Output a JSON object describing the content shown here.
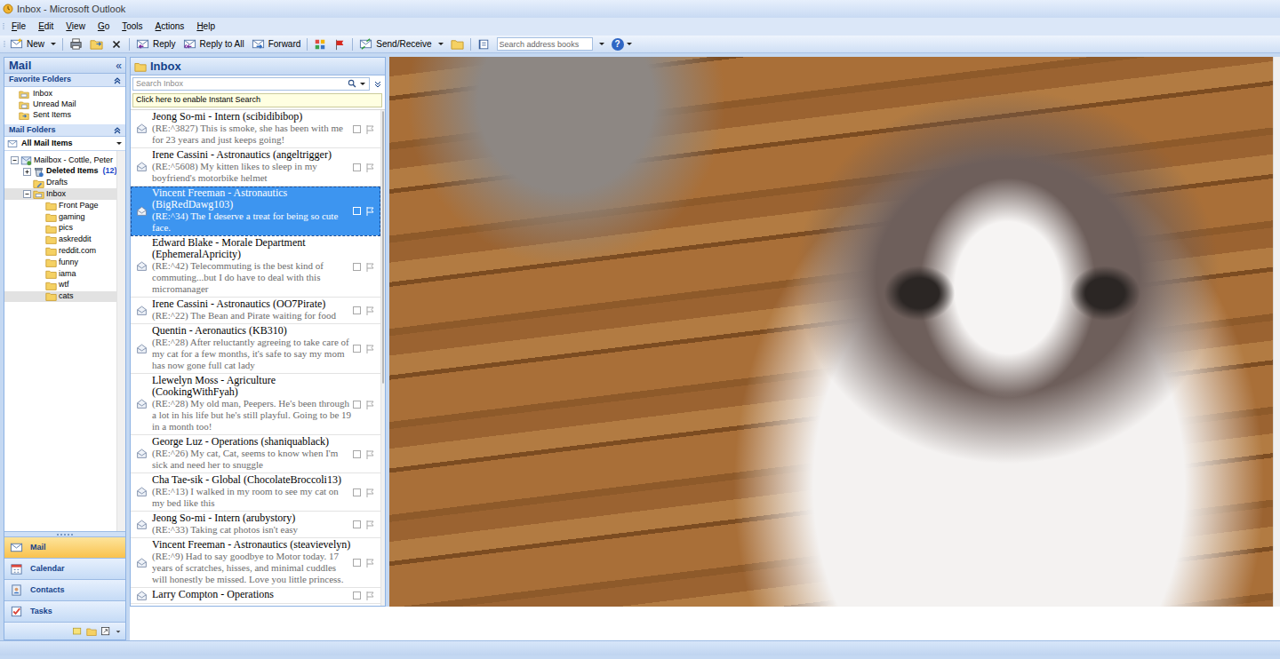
{
  "window": {
    "title": "Inbox - Microsoft Outlook"
  },
  "menu": [
    {
      "label": "File"
    },
    {
      "label": "Edit"
    },
    {
      "label": "View"
    },
    {
      "label": "Go"
    },
    {
      "label": "Tools"
    },
    {
      "label": "Actions"
    },
    {
      "label": "Help"
    }
  ],
  "toolbar": {
    "new": "New",
    "reply": "Reply",
    "reply_all": "Reply to All",
    "forward": "Forward",
    "send_receive": "Send/Receive",
    "search_placeholder": "Search address books",
    "help": "?"
  },
  "nav": {
    "title": "Mail",
    "collapse": "«",
    "favorites_title": "Favorite Folders",
    "favorites": [
      {
        "label": "Inbox"
      },
      {
        "label": "Unread Mail"
      },
      {
        "label": "Sent Items"
      }
    ],
    "folders_title": "Mail Folders",
    "view_label": "All Mail Items",
    "tree": [
      {
        "label": "Mailbox - Cottle, Peter",
        "kind": "mailbox",
        "depth": 0,
        "expandable": true,
        "expanded": true,
        "unread": false,
        "count": "",
        "selected": false
      },
      {
        "label": "Deleted Items",
        "kind": "deleted",
        "depth": 1,
        "expandable": true,
        "expanded": false,
        "unread": true,
        "count": "(12)",
        "selected": false
      },
      {
        "label": "Drafts",
        "kind": "drafts",
        "depth": 1,
        "expandable": false,
        "expanded": false,
        "unread": false,
        "count": "",
        "selected": false
      },
      {
        "label": "Inbox",
        "kind": "inbox",
        "depth": 1,
        "expandable": true,
        "expanded": true,
        "unread": false,
        "count": "",
        "selected": true
      },
      {
        "label": "Front Page",
        "kind": "folder",
        "depth": 2,
        "expandable": false,
        "expanded": false,
        "unread": false,
        "count": "",
        "selected": false
      },
      {
        "label": "gaming",
        "kind": "folder",
        "depth": 2,
        "expandable": false,
        "expanded": false,
        "unread": false,
        "count": "",
        "selected": false
      },
      {
        "label": "pics",
        "kind": "folder",
        "depth": 2,
        "expandable": false,
        "expanded": false,
        "unread": false,
        "count": "",
        "selected": false
      },
      {
        "label": "askreddit",
        "kind": "folder",
        "depth": 2,
        "expandable": false,
        "expanded": false,
        "unread": false,
        "count": "",
        "selected": false
      },
      {
        "label": "reddit.com",
        "kind": "folder",
        "depth": 2,
        "expandable": false,
        "expanded": false,
        "unread": false,
        "count": "",
        "selected": false
      },
      {
        "label": "funny",
        "kind": "folder",
        "depth": 2,
        "expandable": false,
        "expanded": false,
        "unread": false,
        "count": "",
        "selected": false
      },
      {
        "label": "iama",
        "kind": "folder",
        "depth": 2,
        "expandable": false,
        "expanded": false,
        "unread": false,
        "count": "",
        "selected": false
      },
      {
        "label": "wtf",
        "kind": "folder",
        "depth": 2,
        "expandable": false,
        "expanded": false,
        "unread": false,
        "count": "",
        "selected": false
      },
      {
        "label": "cats",
        "kind": "folder",
        "depth": 2,
        "expandable": false,
        "expanded": false,
        "unread": false,
        "count": "",
        "selected": true
      }
    ],
    "buttons": [
      {
        "label": "Mail",
        "kind": "mail",
        "selected": true
      },
      {
        "label": "Calendar",
        "kind": "calendar",
        "selected": false
      },
      {
        "label": "Contacts",
        "kind": "contacts",
        "selected": false
      },
      {
        "label": "Tasks",
        "kind": "tasks",
        "selected": false
      }
    ]
  },
  "message_list": {
    "title": "Inbox",
    "search_placeholder": "Search Inbox",
    "instant_search": "Click here to enable Instant Search",
    "scroll_level": 0.55,
    "messages": [
      {
        "sender": "Jeong So-mi - Intern (scibidibibop)",
        "preview": "(RE:^3827) This is smoke, she has been with me for 23 years and just keeps going!",
        "selected": false
      },
      {
        "sender": "Irene Cassini - Astronautics (angeltrigger)",
        "preview": "(RE:^5608) My kitten likes to sleep in my boyfriend's motorbike helmet",
        "selected": false
      },
      {
        "sender": "Vincent Freeman - Astronautics (BigRedDawg103)",
        "preview": "(RE:^34) The I deserve a treat for being so cute face.",
        "selected": true
      },
      {
        "sender": "Edward Blake - Morale Department (EphemeralApricity)",
        "preview": "(RE:^42) Telecommuting is the best kind of commuting...but I do have to deal with this micromanager",
        "selected": false
      },
      {
        "sender": "Irene Cassini - Astronautics (OO7Pirate)",
        "preview": "(RE:^22) The Bean and Pirate waiting for food",
        "selected": false
      },
      {
        "sender": "Quentin - Aeronautics (KB310)",
        "preview": "(RE:^28) After reluctantly agreeing to take care of my cat for a few months, it's safe to say my mom has now gone full cat lady",
        "selected": false
      },
      {
        "sender": "Llewelyn Moss - Agriculture (CookingWithFyah)",
        "preview": "(RE:^28) My old man, Peepers. He's been through a lot in his life but he's still playful. Going to be 19 in a month too!",
        "selected": false
      },
      {
        "sender": "George Luz - Operations (shaniquablack)",
        "preview": "(RE:^26) My cat, Cat, seems to know when I'm sick and need her to snuggle",
        "selected": false
      },
      {
        "sender": "Cha Tae-sik - Global (ChocolateBroccoli13)",
        "preview": "(RE:^13) I walked in my room to see my cat on my bed like this",
        "selected": false
      },
      {
        "sender": "Jeong So-mi - Intern (arubystory)",
        "preview": "(RE:^33) Taking cat photos isn't easy",
        "selected": false
      },
      {
        "sender": "Vincent Freeman - Astronautics (steavievelyn)",
        "preview": "(RE:^9) Had to say goodbye to Motor today. 17 years of scratches, hisses, and minimal cuddles will honestly be missed. Love you little princess.",
        "selected": false
      },
      {
        "sender": "Larry Compton - Operations",
        "preview": "",
        "selected": false
      }
    ]
  }
}
